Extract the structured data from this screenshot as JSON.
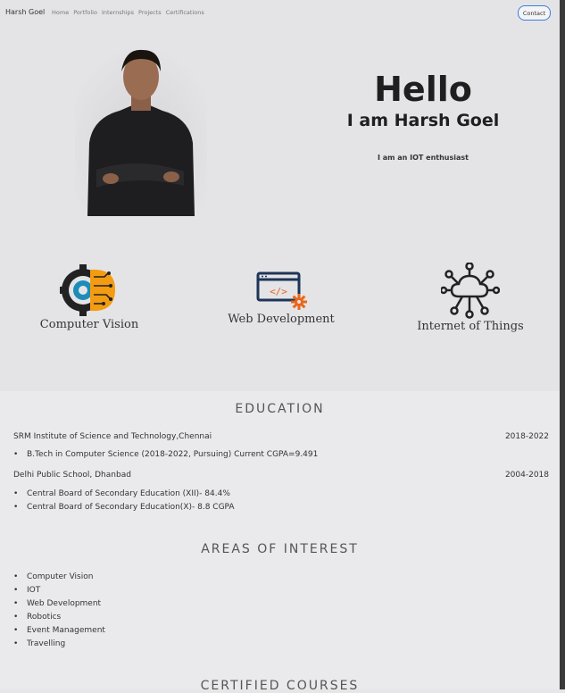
{
  "nav": {
    "brand": "Harsh Goel",
    "links": [
      "Home",
      "Portfolio",
      "Internships",
      "Projects",
      "Certifications"
    ],
    "contact": "Contact"
  },
  "hero": {
    "greeting": "Hello",
    "name_line": "I am Harsh Goel",
    "tagline": "I am an IOT enthusiast"
  },
  "skills": [
    {
      "label": "Computer Vision",
      "icon": "computer-vision-icon"
    },
    {
      "label": "Web Development",
      "icon": "web-development-icon"
    },
    {
      "label": "Internet of Things",
      "icon": "iot-cloud-icon"
    }
  ],
  "education": {
    "title": "EDUCATION",
    "entries": [
      {
        "school": "SRM Institute of Science and Technology,Chennai",
        "years": "2018-2022",
        "details": [
          "B.Tech in Computer Science (2018-2022, Pursuing) Current CGPA=9.491"
        ]
      },
      {
        "school": "Delhi Public School, Dhanbad",
        "years": "2004-2018",
        "details": [
          "Central Board of Secondary Education (XII)- 84.4%",
          "Central Board of Secondary Education(X)- 8.8 CGPA"
        ]
      }
    ]
  },
  "interests": {
    "title": "AREAS OF INTEREST",
    "items": [
      "Computer Vision",
      "IOT",
      "Web Development",
      "Robotics",
      "Event Management",
      "Travelling"
    ]
  },
  "courses": {
    "title": "CERTIFIED COURSES"
  },
  "colors": {
    "accent": "#3b7ddd",
    "orange": "#f39c12",
    "dark": "#222222"
  }
}
